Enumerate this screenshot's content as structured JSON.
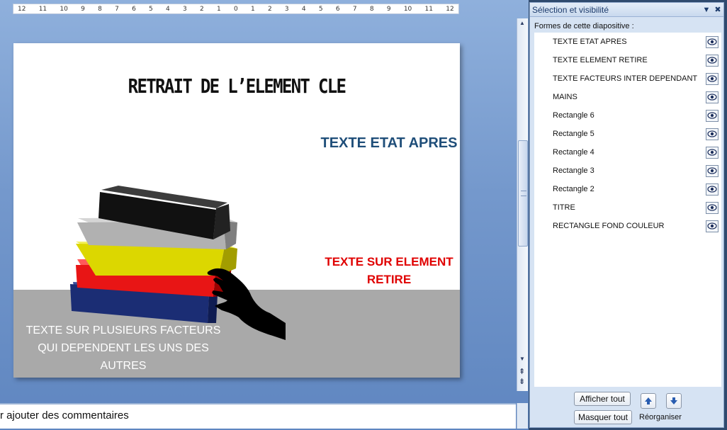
{
  "ruler": {
    "marks": [
      "12",
      "11",
      "10",
      "9",
      "8",
      "7",
      "6",
      "5",
      "4",
      "3",
      "2",
      "1",
      "0",
      "1",
      "2",
      "3",
      "4",
      "5",
      "6",
      "7",
      "8",
      "9",
      "10",
      "11",
      "12"
    ]
  },
  "slide": {
    "title": "RETRAIT DE L’ELEMENT CLE",
    "text_etat_apres": "TEXTE ETAT APRES",
    "text_retire_line1": "TEXTE SUR ELEMENT",
    "text_retire_line2": "RETIRE",
    "text_facteurs_line1": "TEXTE SUR PLUSIEURS FACTEURS",
    "text_facteurs_line2": "QUI DEPENDENT LES UNS DES",
    "text_facteurs_line3": "AUTRES"
  },
  "comments": {
    "text": "r ajouter des commentaires"
  },
  "pane": {
    "title": "Sélection et visibilité",
    "list_label": "Formes de cette diapositive :",
    "shapes": [
      "TEXTE ETAT APRES",
      "TEXTE ELEMENT RETIRE",
      "TEXTE FACTEURS INTER DEPENDANT",
      "MAINS",
      "Rectangle 6",
      "Rectangle 5",
      "Rectangle 4",
      "Rectangle 3",
      "Rectangle 2",
      "TITRE",
      "RECTANGLE FOND COULEUR"
    ],
    "show_all": "Afficher tout",
    "hide_all": "Masquer tout",
    "reorder": "Réorganiser"
  },
  "colors": {
    "title_blue": "#1f4e79",
    "retire_red": "#e00000",
    "bottom_gray": "#a9a9a9"
  }
}
